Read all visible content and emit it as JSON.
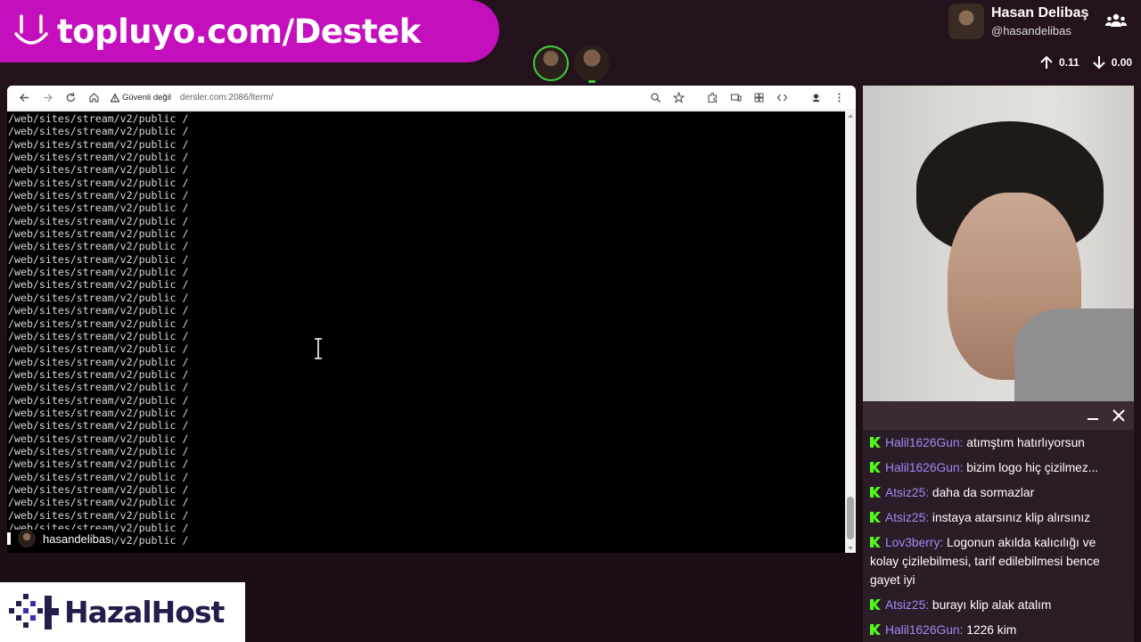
{
  "banner": {
    "text": "topluyo.com/Destek",
    "smile_icon": "smile-icon",
    "color": "#c40fbd"
  },
  "profile": {
    "display_name": "Hasan Delibaş",
    "handle": "@hasandelibas"
  },
  "stats": {
    "up": "0.11",
    "down": "0.00"
  },
  "browser": {
    "security_label": "Güvenli değil",
    "url": "dersler.com:2086/lterm/",
    "terminal_lines": [
      "/web/sites/stream/v2/public /",
      "/web/sites/stream/v2/public /",
      "/web/sites/stream/v2/public /",
      "/web/sites/stream/v2/public /",
      "/web/sites/stream/v2/public /",
      "/web/sites/stream/v2/public /",
      "/web/sites/stream/v2/public /",
      "/web/sites/stream/v2/public /",
      "/web/sites/stream/v2/public /",
      "/web/sites/stream/v2/public /",
      "/web/sites/stream/v2/public /",
      "/web/sites/stream/v2/public /",
      "/web/sites/stream/v2/public /",
      "/web/sites/stream/v2/public /",
      "/web/sites/stream/v2/public /",
      "/web/sites/stream/v2/public /",
      "/web/sites/stream/v2/public /",
      "/web/sites/stream/v2/public /",
      "/web/sites/stream/v2/public /",
      "/web/sites/stream/v2/public /",
      "/web/sites/stream/v2/public /",
      "/web/sites/stream/v2/public /",
      "/web/sites/stream/v2/public /",
      "/web/sites/stream/v2/public /",
      "/web/sites/stream/v2/public /",
      "/web/sites/stream/v2/public /",
      "/web/sites/stream/v2/public /",
      "/web/sites/stream/v2/public /",
      "/web/sites/stream/v2/public /",
      "/web/sites/stream/v2/public /",
      "/web/sites/stream/v2/public /",
      "/web/sites/stream/v2/public /",
      "/web/sites/stream/v2/public /",
      "/web/sites/stream/v2/public /"
    ]
  },
  "caption": {
    "name": "hasandelibas"
  },
  "chat": {
    "messages": [
      {
        "user": "Halil1626Gun",
        "text": "atımştım hatırlıyorsun",
        "trunc": false
      },
      {
        "user": "Halil1626Gun",
        "text": "bizim logo hiç çizilmez...",
        "trunc": true
      },
      {
        "user": "Atsiz25",
        "text": "daha da sormazlar",
        "trunc": false
      },
      {
        "user": "Atsiz25",
        "text": "instaya atarsınız klip alırsınız",
        "trunc": false
      },
      {
        "user": "Lov3berry",
        "text": "Logonun akılda kalıcılığı ve kolay çizilebilmesi, tarif edilebilmesi bence gayet iyi",
        "trunc": false
      },
      {
        "user": "Atsiz25",
        "text": "burayı klip alak atalım",
        "trunc": false
      },
      {
        "user": "Halil1626Gun",
        "text": "1226 kim",
        "trunc": false
      }
    ]
  },
  "sponsor": {
    "text": "HazalHost",
    "color": "#231d4b"
  },
  "colors": {
    "kick_green": "#53fc18",
    "chat_user": "#9f8cf3",
    "live_ring": "#3ecf3e"
  }
}
